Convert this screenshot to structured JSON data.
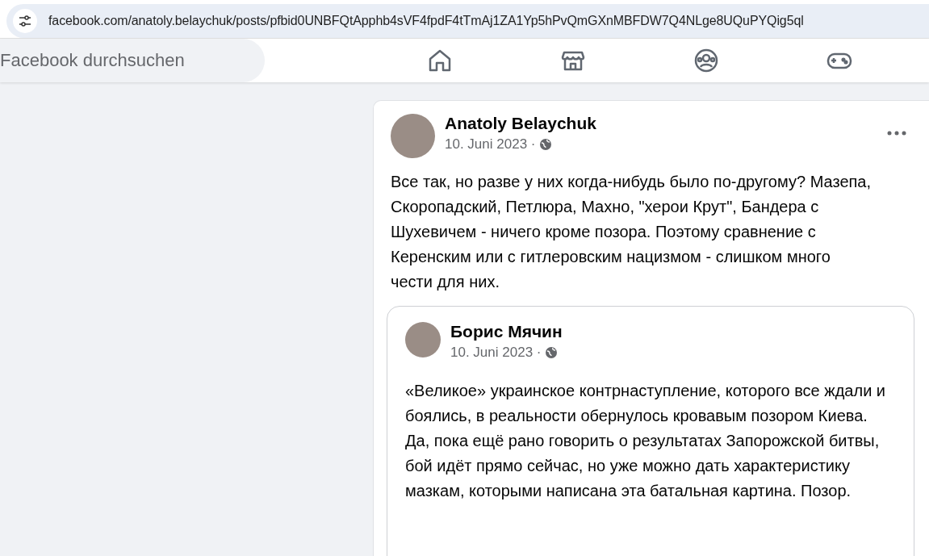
{
  "address_bar": {
    "url": "facebook.com/anatoly.belaychuk/posts/pfbid0UNBFQtApphb4sVF4fpdF4tTmAj1ZA1Yp5hPvQmGXnMBFDW7Q4NLge8UQuPYQig5ql"
  },
  "search": {
    "placeholder": "Facebook durchsuchen"
  },
  "nav_tabs": [
    {
      "kind": "home",
      "selected": false
    },
    {
      "kind": "marketplace",
      "selected": false
    },
    {
      "kind": "groups",
      "selected": false
    },
    {
      "kind": "gaming",
      "selected": false
    }
  ],
  "post": {
    "author": "Anatoly Belaychuk",
    "date": "10. Juni 2023 ·",
    "text": "Все так, но разве у них когда-нибудь было по-другому? Мазепа, Скоропадский, Петлюра, Махно, \"херои Крут\", Бандера с Шухевичем - ничего кроме позора. Поэтому сравнение с Керенским или с гитлеровским нацизмом - слишком много чести для них.",
    "shared_post": {
      "author": "Борис Мячин",
      "date": "10. Juni 2023 ·",
      "text": "«Великое» украинское контрнаступление, которого все ждали и боялись, в реальности обернулось кровавым позором Киева. Да, пока ещё рано говорить о результатах Запорожской битвы, бой идёт прямо сейчас, но уже можно дать характеристику мазкам, которыми написана эта батальная картина. Позор."
    }
  }
}
